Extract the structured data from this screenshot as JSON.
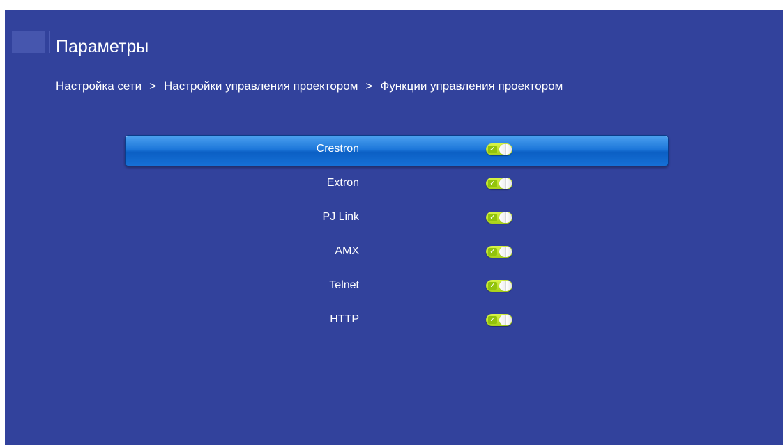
{
  "header": {
    "title": "Параметры"
  },
  "breadcrumb": {
    "items": [
      "Настройка сети",
      "Настройки управления проектором",
      "Функции управления проектором"
    ],
    "separator": ">"
  },
  "menu": {
    "items": [
      {
        "label": "Crestron",
        "state": "on",
        "selected": true
      },
      {
        "label": "Extron",
        "state": "on",
        "selected": false
      },
      {
        "label": "PJ Link",
        "state": "on",
        "selected": false
      },
      {
        "label": "AMX",
        "state": "on",
        "selected": false
      },
      {
        "label": "Telnet",
        "state": "on",
        "selected": false
      },
      {
        "label": "HTTP",
        "state": "on",
        "selected": false
      }
    ]
  },
  "icons": {
    "toggle_check": "check-icon"
  },
  "colors": {
    "background": "#32429c",
    "selection": "#1d77da",
    "toggle_on": "#c2e32f",
    "text": "#ffffff"
  }
}
